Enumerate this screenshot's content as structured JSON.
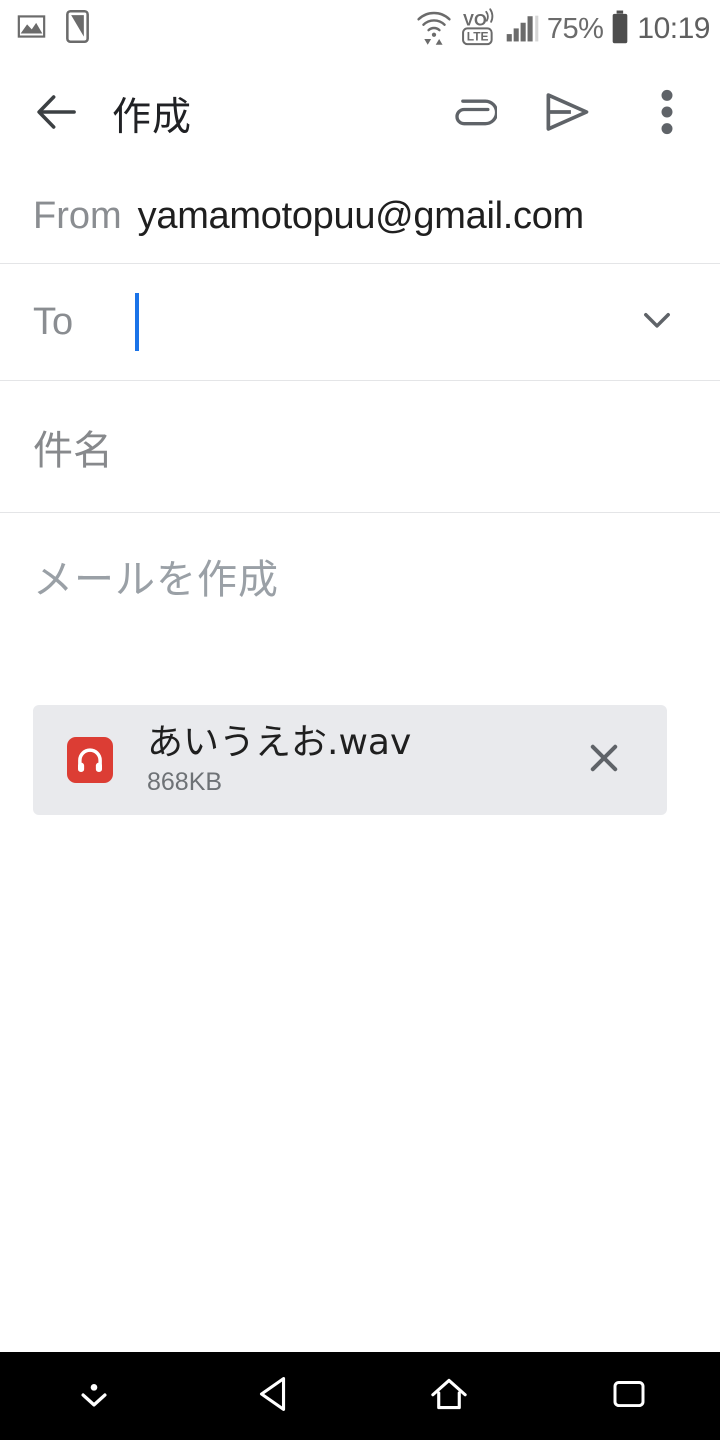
{
  "status_bar": {
    "left_icons": [
      "screenshot-image-icon",
      "device-phone-icon"
    ],
    "right_icons": [
      "wifi-data-icon",
      "volte-icon",
      "signal-bars-icon",
      "battery-icon"
    ],
    "battery_percent": "75%",
    "clock": "10:19"
  },
  "toolbar": {
    "back_icon": "back-arrow-icon",
    "title": "作成",
    "attach_icon": "paperclip-icon",
    "send_icon": "send-icon",
    "more_icon": "overflow-menu-icon"
  },
  "compose": {
    "from": {
      "label": "From",
      "value": "yamamotopuu@gmail.com"
    },
    "to": {
      "label": "To",
      "value": "",
      "expand_icon": "chevron-down-icon"
    },
    "subject": {
      "value": "",
      "placeholder": "件名"
    },
    "body": {
      "value": "",
      "placeholder": "メールを作成"
    }
  },
  "attachment": {
    "file_icon": "audio-headphone-icon",
    "name": "あいうえお.wav",
    "size": "868KB",
    "remove_icon": "close-icon"
  },
  "nav_bar": {
    "hide_icon": "hide-navbar-icon",
    "back_icon": "nav-back-icon",
    "home_icon": "nav-home-icon",
    "recents_icon": "nav-recents-icon"
  },
  "colors": {
    "accent": "#1a73e8",
    "chip_background": "#e9eaed",
    "file_icon": "#dc3d34",
    "navbar": "#000000",
    "divider": "#e4e5e7"
  }
}
